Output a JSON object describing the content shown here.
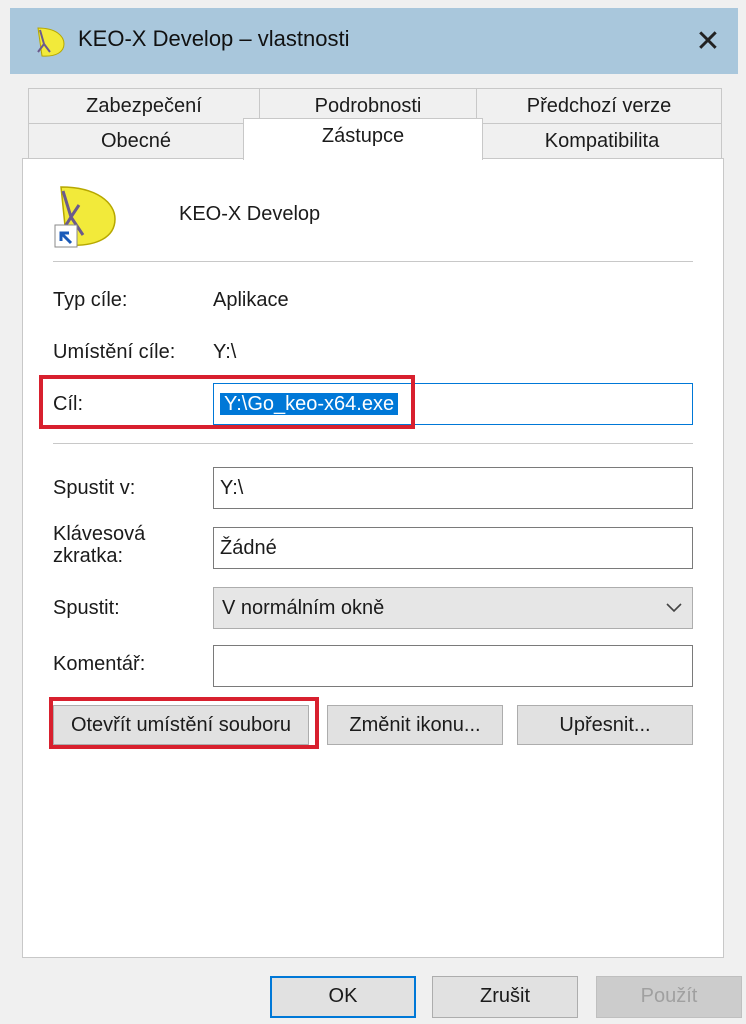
{
  "window": {
    "title": "KEO-X Develop – vlastnosti",
    "close_glyph": "✕"
  },
  "tabs": {
    "row1": [
      "Zabezpečení",
      "Podrobnosti",
      "Předchozí verze"
    ],
    "row2": [
      "Obecné",
      "Zástupce",
      "Kompatibilita"
    ],
    "active": "Zástupce"
  },
  "shortcut": {
    "name": "KEO-X Develop",
    "target_type_label": "Typ cíle:",
    "target_type_value": "Aplikace",
    "target_location_label": "Umístění cíle:",
    "target_location_value": "Y:\\",
    "target_label": "Cíl:",
    "target_value": "Y:\\Go_keo-x64.exe",
    "start_in_label": "Spustit v:",
    "start_in_value": "Y:\\",
    "hotkey_label_line1": "Klávesová",
    "hotkey_label_line2": "zkratka:",
    "hotkey_value": "Žádné",
    "run_label": "Spustit:",
    "run_value": "V normálním okně",
    "comment_label": "Komentář:",
    "comment_value": ""
  },
  "buttons": {
    "open_location": "Otevřít umístění souboru",
    "change_icon": "Změnit ikonu...",
    "advanced": "Upřesnit...",
    "ok": "OK",
    "cancel": "Zrušit",
    "apply": "Použít"
  },
  "colors": {
    "highlight": "#d8202e",
    "accent": "#0078d7",
    "titlebar": "#a9c7dc"
  }
}
